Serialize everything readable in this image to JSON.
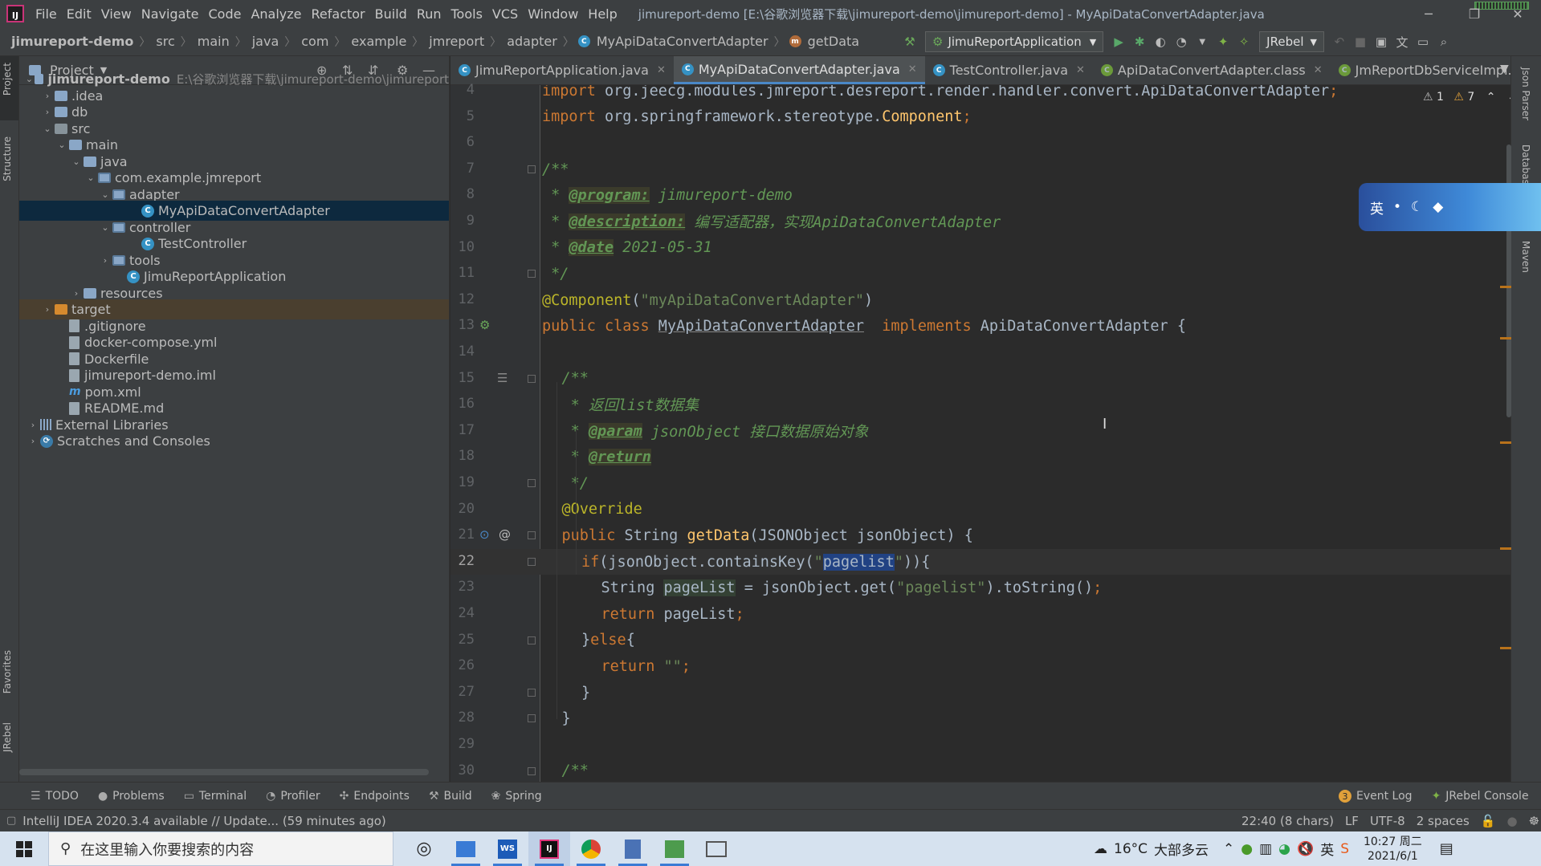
{
  "window": {
    "title": "jimureport-demo [E:\\谷歌浏览器下载\\jimureport-demo\\jimureport-demo] - MyApiDataConvertAdapter.java",
    "logo_text": "IJ",
    "controls": {
      "minimize": "─",
      "restore": "❐",
      "close": "✕"
    }
  },
  "menu": [
    "File",
    "Edit",
    "View",
    "Navigate",
    "Code",
    "Analyze",
    "Refactor",
    "Build",
    "Run",
    "Tools",
    "VCS",
    "Window",
    "Help"
  ],
  "breadcrumb": [
    "jimureport-demo",
    "src",
    "main",
    "java",
    "com",
    "example",
    "jmreport",
    "adapter",
    "MyApiDataConvertAdapter",
    "getData"
  ],
  "run_config": "JimuReportApplication",
  "jrebel_label": "JRebel",
  "project_panel": {
    "title": "Project",
    "tree": [
      {
        "label": "jimureport-demo",
        "path": "E:\\谷歌浏览器下载\\jimureport-demo\\jimureport",
        "icon": "module",
        "depth": 0,
        "arrow": "down",
        "bold": true
      },
      {
        "label": ".idea",
        "icon": "folder",
        "depth": 1,
        "arrow": "right"
      },
      {
        "label": "db",
        "icon": "folder",
        "depth": 1,
        "arrow": "right"
      },
      {
        "label": "src",
        "icon": "folder-src",
        "depth": 1,
        "arrow": "down"
      },
      {
        "label": "main",
        "icon": "folder",
        "depth": 2,
        "arrow": "down"
      },
      {
        "label": "java",
        "icon": "folder",
        "depth": 3,
        "arrow": "down"
      },
      {
        "label": "com.example.jmreport",
        "icon": "package",
        "depth": 4,
        "arrow": "down"
      },
      {
        "label": "adapter",
        "icon": "package",
        "depth": 5,
        "arrow": "down"
      },
      {
        "label": "MyApiDataConvertAdapter",
        "icon": "class",
        "depth": 7,
        "arrow": "",
        "selected": true
      },
      {
        "label": "controller",
        "icon": "package",
        "depth": 5,
        "arrow": "down"
      },
      {
        "label": "TestController",
        "icon": "class",
        "depth": 7,
        "arrow": ""
      },
      {
        "label": "tools",
        "icon": "package",
        "depth": 5,
        "arrow": "right"
      },
      {
        "label": "JimuReportApplication",
        "icon": "class-run",
        "depth": 6,
        "arrow": ""
      },
      {
        "label": "resources",
        "icon": "folder",
        "depth": 3,
        "arrow": "right"
      },
      {
        "label": "target",
        "icon": "folder-target",
        "depth": 1,
        "arrow": "right",
        "excluded": true
      },
      {
        "label": ".gitignore",
        "icon": "file",
        "depth": 2,
        "arrow": ""
      },
      {
        "label": "docker-compose.yml",
        "icon": "file",
        "depth": 2,
        "arrow": ""
      },
      {
        "label": "Dockerfile",
        "icon": "file",
        "depth": 2,
        "arrow": ""
      },
      {
        "label": "jimureport-demo.iml",
        "icon": "file",
        "depth": 2,
        "arrow": ""
      },
      {
        "label": "pom.xml",
        "icon": "maven",
        "depth": 2,
        "arrow": ""
      },
      {
        "label": "README.md",
        "icon": "file",
        "depth": 2,
        "arrow": ""
      },
      {
        "label": "External Libraries",
        "icon": "lib",
        "depth": 0,
        "arrow": "right"
      },
      {
        "label": "Scratches and Consoles",
        "icon": "scratch",
        "depth": 0,
        "arrow": "right"
      }
    ]
  },
  "left_tool_tabs": [
    "Project",
    "Structure",
    "Favorites",
    "JRebel"
  ],
  "right_tool_tabs": [
    "Json Parser",
    "Database",
    "Maven"
  ],
  "tabs": [
    {
      "label": "JimuReportApplication.java",
      "kind": "java",
      "active": false
    },
    {
      "label": "MyApiDataConvertAdapter.java",
      "kind": "java",
      "active": true
    },
    {
      "label": "TestController.java",
      "kind": "java",
      "active": false
    },
    {
      "label": "ApiDataConvertAdapter.class",
      "kind": "class",
      "active": false
    },
    {
      "label": "JmReportDbServiceImpl.class",
      "kind": "class",
      "active": false
    }
  ],
  "inspections": {
    "warnings": "1",
    "weak_warnings": "7"
  },
  "ime_label": "英",
  "editor": {
    "current_line": 22,
    "lines": [
      {
        "n": 4,
        "indent": 0,
        "tokens": [
          [
            "kw",
            "import "
          ],
          [
            "",
            "org.jeecg.modules.jmreport.desreport.render.handler.convert.ApiDataConvertAdapter"
          ],
          [
            "kw",
            ";"
          ]
        ]
      },
      {
        "n": 5,
        "indent": 0,
        "tokens": [
          [
            "kw",
            "import "
          ],
          [
            "",
            "org.springframework.stereotype."
          ],
          [
            "cn",
            "Component"
          ],
          [
            "kw",
            ";"
          ]
        ]
      },
      {
        "n": 6,
        "indent": 0,
        "tokens": []
      },
      {
        "n": 7,
        "indent": 0,
        "tokens": [
          [
            "doc",
            "/**"
          ]
        ]
      },
      {
        "n": 8,
        "indent": 0,
        "tokens": [
          [
            "doc",
            " * "
          ],
          [
            "doctag",
            "@program:"
          ],
          [
            "doc",
            " jimureport-demo"
          ]
        ]
      },
      {
        "n": 9,
        "indent": 0,
        "tokens": [
          [
            "doc",
            " * "
          ],
          [
            "doctag",
            "@description:"
          ],
          [
            "doc",
            " 编写适配器，实现ApiDataConvertAdapter"
          ]
        ]
      },
      {
        "n": 10,
        "indent": 0,
        "tokens": [
          [
            "doc",
            " * "
          ],
          [
            "doctag",
            "@date"
          ],
          [
            "doc",
            " 2021-05-31"
          ]
        ]
      },
      {
        "n": 11,
        "indent": 0,
        "tokens": [
          [
            "doc",
            " */"
          ]
        ]
      },
      {
        "n": 12,
        "indent": 0,
        "tokens": [
          [
            "ann",
            "@Component"
          ],
          [
            "",
            "("
          ],
          [
            "str",
            "\"myApiDataConvertAdapter\""
          ],
          [
            "",
            ")"
          ]
        ]
      },
      {
        "n": 13,
        "indent": 0,
        "tokens": [
          [
            "kw",
            "public class "
          ],
          [
            "und",
            "MyApiDataConvertAdapter"
          ],
          [
            "",
            "  "
          ],
          [
            "kw",
            "implements "
          ],
          [
            "",
            "ApiDataConvertAdapter {"
          ]
        ]
      },
      {
        "n": 14,
        "indent": 0,
        "tokens": []
      },
      {
        "n": 15,
        "indent": 1,
        "tokens": [
          [
            "doc",
            "/**"
          ]
        ]
      },
      {
        "n": 16,
        "indent": 1,
        "tokens": [
          [
            "doc",
            " * 返回list数据集"
          ]
        ]
      },
      {
        "n": 17,
        "indent": 1,
        "tokens": [
          [
            "doc",
            " * "
          ],
          [
            "doctag",
            "@param"
          ],
          [
            "doc",
            " jsonObject 接口数据原始对象"
          ]
        ]
      },
      {
        "n": 18,
        "indent": 1,
        "tokens": [
          [
            "doc",
            " * "
          ],
          [
            "doctag",
            "@return"
          ]
        ]
      },
      {
        "n": 19,
        "indent": 1,
        "tokens": [
          [
            "doc",
            " */"
          ]
        ]
      },
      {
        "n": 20,
        "indent": 1,
        "tokens": [
          [
            "ann",
            "@Override"
          ]
        ]
      },
      {
        "n": 21,
        "indent": 1,
        "tokens": [
          [
            "kw",
            "public "
          ],
          [
            "",
            "String "
          ],
          [
            "fn",
            "getData"
          ],
          [
            "",
            "(JSONObject jsonObject) {"
          ]
        ]
      },
      {
        "n": 22,
        "indent": 2,
        "tokens": [
          [
            "kw",
            "if"
          ],
          [
            "",
            "(jsonObject.containsKey("
          ],
          [
            "str",
            "\""
          ],
          [
            "sel",
            "pagelist"
          ],
          [
            "str",
            "\""
          ],
          [
            "",
            "))"
          ],
          [
            "",
            "{"
          ]
        ]
      },
      {
        "n": 23,
        "indent": 3,
        "tokens": [
          [
            "",
            "String "
          ],
          [
            "hl-var",
            "pageList"
          ],
          [
            "",
            " = jsonObject.get("
          ],
          [
            "str",
            "\"pagelist\""
          ],
          [
            "",
            ").toString()"
          ],
          [
            "kw",
            ";"
          ]
        ]
      },
      {
        "n": 24,
        "indent": 3,
        "tokens": [
          [
            "kw",
            "return "
          ],
          [
            "",
            "pageList"
          ],
          [
            "kw",
            ";"
          ]
        ]
      },
      {
        "n": 25,
        "indent": 2,
        "tokens": [
          [
            "",
            "}"
          ],
          [
            "kw",
            "else"
          ],
          [
            "",
            "{"
          ]
        ]
      },
      {
        "n": 26,
        "indent": 3,
        "tokens": [
          [
            "kw",
            "return "
          ],
          [
            "str",
            "\"\""
          ],
          [
            "kw",
            ";"
          ]
        ]
      },
      {
        "n": 27,
        "indent": 2,
        "tokens": [
          [
            "",
            "}"
          ]
        ]
      },
      {
        "n": 28,
        "indent": 1,
        "tokens": [
          [
            "",
            "}"
          ]
        ]
      },
      {
        "n": 29,
        "indent": 0,
        "tokens": []
      },
      {
        "n": 30,
        "indent": 1,
        "tokens": [
          [
            "doc",
            "/**"
          ]
        ]
      }
    ]
  },
  "bottom_tools": [
    {
      "label": "TODO",
      "icon": "list-icon"
    },
    {
      "label": "Problems",
      "icon": "problems-icon"
    },
    {
      "label": "Terminal",
      "icon": "terminal-icon"
    },
    {
      "label": "Profiler",
      "icon": "profiler-icon"
    },
    {
      "label": "Endpoints",
      "icon": "endpoints-icon"
    },
    {
      "label": "Build",
      "icon": "build-icon"
    },
    {
      "label": "Spring",
      "icon": "spring-icon"
    }
  ],
  "bottom_right_tools": [
    {
      "label": "Event Log",
      "badge": "3"
    },
    {
      "label": "JRebel Console"
    }
  ],
  "status": {
    "message": "IntelliJ IDEA 2020.3.4 available // Update... (59 minutes ago)",
    "position": "22:40 (8 chars)",
    "line_sep": "LF",
    "encoding": "UTF-8",
    "indent": "2 spaces"
  },
  "taskbar": {
    "search_placeholder": "在这里输入你要搜索的内容",
    "weather_temp": "16°C",
    "weather_desc": "大部多云",
    "time": "10:27 周二",
    "date": "2021/6/1"
  },
  "colors": {
    "accent": "#4a88c7",
    "selection": "#214283",
    "keyword": "#cc7832",
    "string": "#6a8759",
    "doc": "#629755",
    "annotation": "#bbb529"
  }
}
